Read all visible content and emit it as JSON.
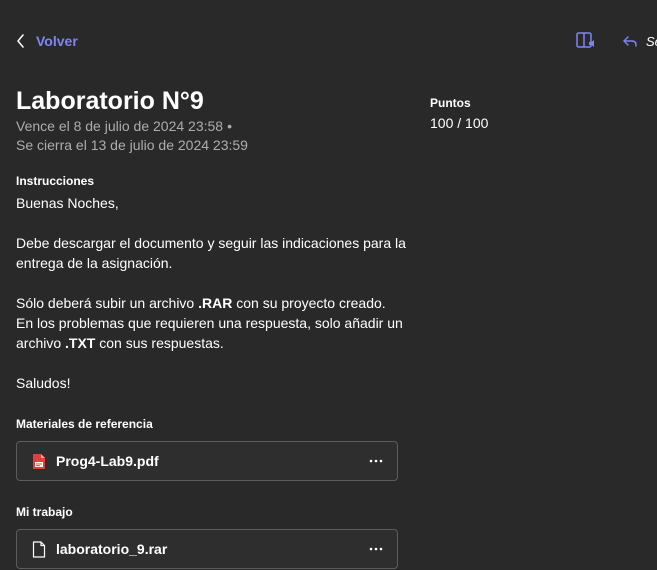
{
  "nav": {
    "back_label": "Volver",
    "send_label": "Se"
  },
  "assignment": {
    "title": "Laboratorio N°9",
    "due": "Vence el 8 de julio de 2024 23:58",
    "due_separator": "•",
    "closes": "Se cierra el 13 de julio de 2024 23:59"
  },
  "points": {
    "label": "Puntos",
    "value": "100 / 100"
  },
  "instructions": {
    "label": "Instrucciones",
    "greeting": "Buenas Noches,",
    "para1": "Debe descargar el documento y seguir las indicaciones para la entrega de la asignación.",
    "para2_prefix": "Sólo deberá subir un archivo ",
    "para2_bold1": ".RAR",
    "para2_middle": " con su proyecto creado. En los problemas que requieren una respuesta, solo añadir un archivo ",
    "para2_bold2": ".TXT",
    "para2_suffix": " con sus respuestas.",
    "closing": "Saludos!"
  },
  "reference": {
    "label": "Materiales de referencia",
    "file_name": "Prog4-Lab9.pdf"
  },
  "work": {
    "label": "Mi trabajo",
    "file_name": "laboratorio_9.rar"
  },
  "colors": {
    "background": "#292929",
    "accent": "#7f85f5",
    "muted_text": "#adadad",
    "pdf_red": "#e0403a"
  },
  "icons": {
    "back": "chevron-left-icon",
    "reader": "immersive-reader-icon",
    "send": "reply-arrow-icon",
    "pdf": "pdf-file-icon",
    "file": "file-icon",
    "more": "more-options-icon"
  }
}
